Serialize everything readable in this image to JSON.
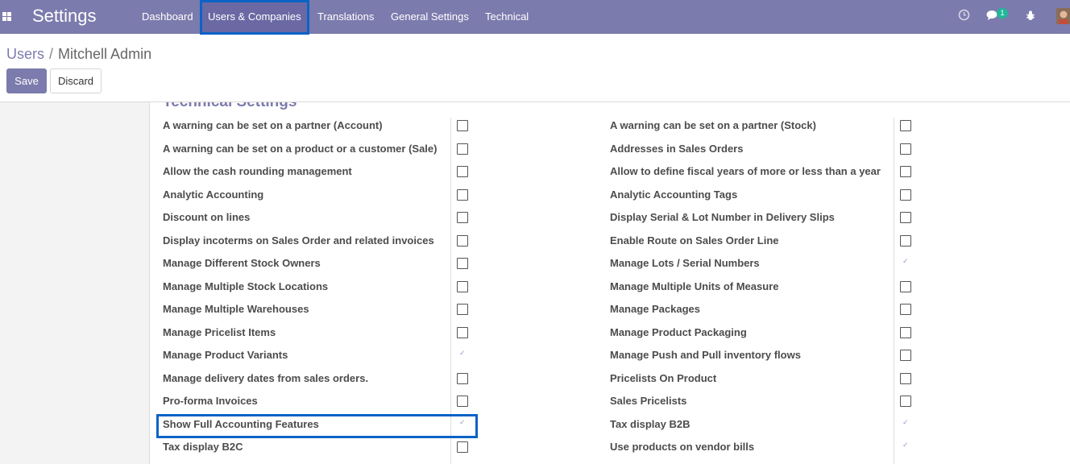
{
  "navbar": {
    "app_title": "Settings",
    "menu": [
      "Dashboard",
      "Users & Companies",
      "Translations",
      "General Settings",
      "Technical"
    ],
    "chat_count": "1",
    "icons": [
      "apps-grid-icon",
      "clock-icon",
      "chat-icon",
      "bug-icon",
      "avatar"
    ]
  },
  "breadcrumb": {
    "parent": "Users",
    "separator": "/",
    "current": "Mitchell Admin"
  },
  "buttons": {
    "save": "Save",
    "discard": "Discard"
  },
  "section": {
    "title": "Technical Settings"
  },
  "left_rows": [
    {
      "label": "A warning can be set on a partner (Account)",
      "checked": false
    },
    {
      "label": "A warning can be set on a product or a customer (Sale)",
      "checked": false
    },
    {
      "label": "Allow the cash rounding management",
      "checked": false
    },
    {
      "label": "Analytic Accounting",
      "checked": false
    },
    {
      "label": "Discount on lines",
      "checked": false
    },
    {
      "label": "Display incoterms on Sales Order and related invoices",
      "checked": false
    },
    {
      "label": "Manage Different Stock Owners",
      "checked": false
    },
    {
      "label": "Manage Multiple Stock Locations",
      "checked": false
    },
    {
      "label": "Manage Multiple Warehouses",
      "checked": false
    },
    {
      "label": "Manage Pricelist Items",
      "checked": false
    },
    {
      "label": "Manage Product Variants",
      "checked": true
    },
    {
      "label": "Manage delivery dates from sales orders.",
      "checked": false
    },
    {
      "label": "Pro-forma Invoices",
      "checked": false
    },
    {
      "label": "Show Full Accounting Features",
      "checked": true
    },
    {
      "label": "Tax display B2C",
      "checked": false
    }
  ],
  "right_rows": [
    {
      "label": "A warning can be set on a partner (Stock)",
      "checked": false
    },
    {
      "label": "Addresses in Sales Orders",
      "checked": false
    },
    {
      "label": "Allow to define fiscal years of more or less than a year",
      "checked": false
    },
    {
      "label": "Analytic Accounting Tags",
      "checked": false
    },
    {
      "label": "Display Serial & Lot Number in Delivery Slips",
      "checked": false
    },
    {
      "label": "Enable Route on Sales Order Line",
      "checked": false
    },
    {
      "label": "Manage Lots / Serial Numbers",
      "checked": true
    },
    {
      "label": "Manage Multiple Units of Measure",
      "checked": false
    },
    {
      "label": "Manage Packages",
      "checked": false
    },
    {
      "label": "Manage Product Packaging",
      "checked": false
    },
    {
      "label": "Manage Push and Pull inventory flows",
      "checked": false
    },
    {
      "label": "Pricelists On Product",
      "checked": false
    },
    {
      "label": "Sales Pricelists",
      "checked": false
    },
    {
      "label": "Tax display B2B",
      "checked": true
    },
    {
      "label": "Use products on vendor bills",
      "checked": true
    }
  ],
  "colors": {
    "navbar": "#7c7bad",
    "highlight": "#0b63c6",
    "section_title": "#7c7bad",
    "badge": "#21b799"
  }
}
